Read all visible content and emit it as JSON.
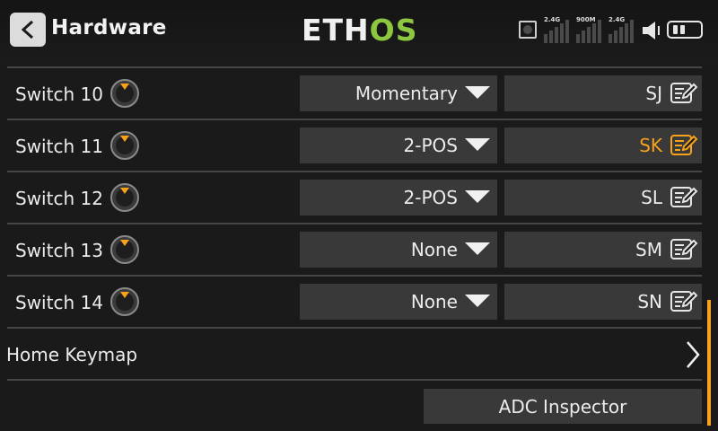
{
  "header": {
    "title": "Hardware",
    "logo_part1": "ETH",
    "logo_part2": "OS",
    "status": {
      "bands": [
        "2.4G",
        "900M",
        "2.4G"
      ],
      "icons": [
        "sim-icon",
        "signal-icon",
        "speaker-icon",
        "battery-icon"
      ]
    }
  },
  "switches": [
    {
      "label": "Switch 10",
      "type": "Momentary",
      "name": "SJ",
      "active": false
    },
    {
      "label": "Switch 11",
      "type": "2-POS",
      "name": "SK",
      "active": true
    },
    {
      "label": "Switch 12",
      "type": "2-POS",
      "name": "SL",
      "active": false
    },
    {
      "label": "Switch 13",
      "type": "None",
      "name": "SM",
      "active": false
    },
    {
      "label": "Switch 14",
      "type": "None",
      "name": "SN",
      "active": false
    }
  ],
  "home_keymap": {
    "label": "Home Keymap"
  },
  "adc_button": {
    "label": "ADC Inspector"
  },
  "colors": {
    "accent": "#f7a21b",
    "logo_green": "#8dc63f",
    "field_bg": "#393939",
    "background": "#1a1a1a"
  }
}
